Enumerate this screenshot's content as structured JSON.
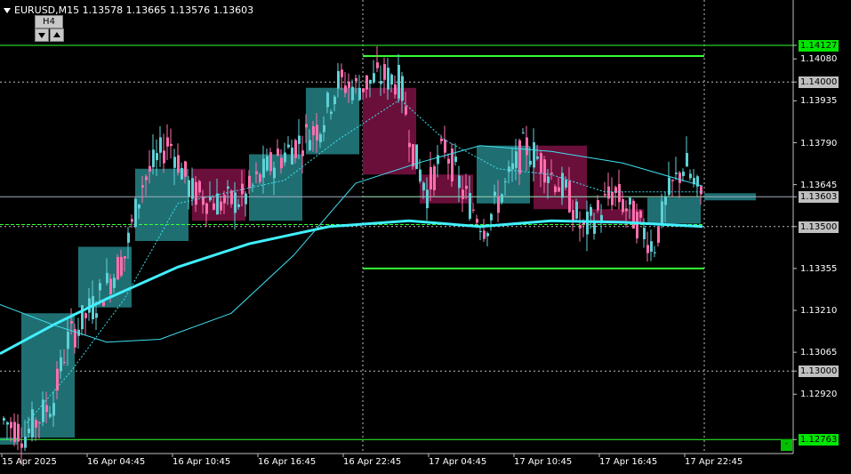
{
  "header": {
    "symbol": "EURUSD,M15",
    "ohlc": "1.13578 1.13665 1.13576 1.13603"
  },
  "timeframe_button": {
    "label": "H4"
  },
  "corner_button": {
    "label": "-"
  },
  "colors": {
    "background": "#000000",
    "bull_candle": "#5fd0d6",
    "bear_candle": "#ff6fae",
    "bull_box": "#1f6f72",
    "bear_box": "#6a0f3a",
    "level_line": "#33ff33",
    "ma_thick": "#40f0ff",
    "ma_thin": "#40e0f0",
    "grid": "#c0c0c0"
  },
  "price_axis": {
    "min": 1.1273,
    "max": 1.1425,
    "labels": [
      {
        "text": "1.14127",
        "price": 1.14127,
        "style": "green"
      },
      {
        "text": "1.14080",
        "price": 1.1408,
        "style": "plain"
      },
      {
        "text": "1.14000",
        "price": 1.14,
        "style": "gray"
      },
      {
        "text": "1.13935",
        "price": 1.13935,
        "style": "plain"
      },
      {
        "text": "1.13790",
        "price": 1.1379,
        "style": "plain"
      },
      {
        "text": "1.13645",
        "price": 1.13645,
        "style": "plain"
      },
      {
        "text": "1.13603",
        "price": 1.13603,
        "style": "cur"
      },
      {
        "text": "1.13500",
        "price": 1.135,
        "style": "gray"
      },
      {
        "text": "1.13355",
        "price": 1.13355,
        "style": "plain"
      },
      {
        "text": "1.13210",
        "price": 1.1321,
        "style": "plain"
      },
      {
        "text": "1.13065",
        "price": 1.13065,
        "style": "plain"
      },
      {
        "text": "1.13000",
        "price": 1.13,
        "style": "gray"
      },
      {
        "text": "1.12920",
        "price": 1.1292,
        "style": "plain"
      },
      {
        "text": "1.12763",
        "price": 1.12763,
        "style": "green"
      }
    ]
  },
  "time_axis": {
    "labels": [
      {
        "text": "15 Apr 2025",
        "index": 0
      },
      {
        "text": "16 Apr 04:45",
        "index": 1
      },
      {
        "text": "16 Apr 10:45",
        "index": 2
      },
      {
        "text": "16 Apr 16:45",
        "index": 3
      },
      {
        "text": "16 Apr 22:45",
        "index": 4
      },
      {
        "text": "17 Apr 04:45",
        "index": 5
      },
      {
        "text": "17 Apr 10:45",
        "index": 6
      },
      {
        "text": "17 Apr 16:45",
        "index": 7
      },
      {
        "text": "17 Apr 22:45",
        "index": 8
      }
    ]
  },
  "levels": {
    "hline_solid": [
      1.14127,
      1.12763
    ],
    "hline_dotted": [
      1.14,
      1.135,
      1.13
    ],
    "current_price": 1.13603,
    "session_high": 1.1409,
    "session_low": 1.13355,
    "session_mid": 1.13603
  },
  "h4_boxes": [
    {
      "o": 1.1277,
      "c": 1.132,
      "dir": "bull"
    },
    {
      "o": 1.1322,
      "c": 1.1343,
      "dir": "bull"
    },
    {
      "o": 1.1345,
      "c": 1.137,
      "dir": "bull"
    },
    {
      "o": 1.137,
      "c": 1.1352,
      "dir": "bear"
    },
    {
      "o": 1.1352,
      "c": 1.1375,
      "dir": "bull"
    },
    {
      "o": 1.1375,
      "c": 1.1398,
      "dir": "bull"
    },
    {
      "o": 1.1398,
      "c": 1.1368,
      "dir": "bear"
    },
    {
      "o": 1.1368,
      "c": 1.1358,
      "dir": "bear"
    },
    {
      "o": 1.1358,
      "c": 1.1378,
      "dir": "bull"
    },
    {
      "o": 1.1378,
      "c": 1.1356,
      "dir": "bear"
    },
    {
      "o": 1.1356,
      "c": 1.1351,
      "dir": "bear"
    },
    {
      "o": 1.1351,
      "c": 1.136,
      "dir": "bull"
    }
  ]
}
